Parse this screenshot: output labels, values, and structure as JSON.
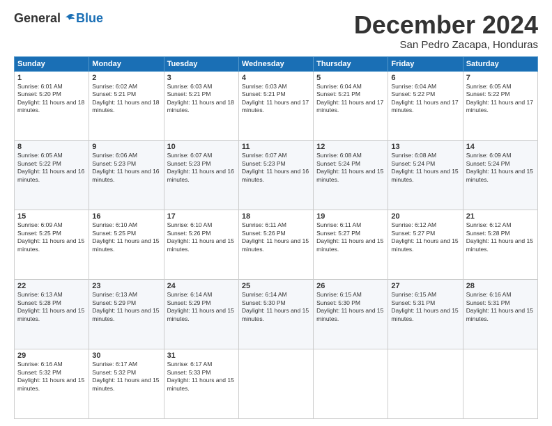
{
  "logo": {
    "general": "General",
    "blue": "Blue"
  },
  "title": "December 2024",
  "location": "San Pedro Zacapa, Honduras",
  "weekdays": [
    "Sunday",
    "Monday",
    "Tuesday",
    "Wednesday",
    "Thursday",
    "Friday",
    "Saturday"
  ],
  "weeks": [
    [
      {
        "day": "1",
        "sunrise": "6:01 AM",
        "sunset": "5:20 PM",
        "daylight": "11 hours and 18 minutes."
      },
      {
        "day": "2",
        "sunrise": "6:02 AM",
        "sunset": "5:21 PM",
        "daylight": "11 hours and 18 minutes."
      },
      {
        "day": "3",
        "sunrise": "6:03 AM",
        "sunset": "5:21 PM",
        "daylight": "11 hours and 18 minutes."
      },
      {
        "day": "4",
        "sunrise": "6:03 AM",
        "sunset": "5:21 PM",
        "daylight": "11 hours and 17 minutes."
      },
      {
        "day": "5",
        "sunrise": "6:04 AM",
        "sunset": "5:21 PM",
        "daylight": "11 hours and 17 minutes."
      },
      {
        "day": "6",
        "sunrise": "6:04 AM",
        "sunset": "5:22 PM",
        "daylight": "11 hours and 17 minutes."
      },
      {
        "day": "7",
        "sunrise": "6:05 AM",
        "sunset": "5:22 PM",
        "daylight": "11 hours and 17 minutes."
      }
    ],
    [
      {
        "day": "8",
        "sunrise": "6:05 AM",
        "sunset": "5:22 PM",
        "daylight": "11 hours and 16 minutes."
      },
      {
        "day": "9",
        "sunrise": "6:06 AM",
        "sunset": "5:23 PM",
        "daylight": "11 hours and 16 minutes."
      },
      {
        "day": "10",
        "sunrise": "6:07 AM",
        "sunset": "5:23 PM",
        "daylight": "11 hours and 16 minutes."
      },
      {
        "day": "11",
        "sunrise": "6:07 AM",
        "sunset": "5:23 PM",
        "daylight": "11 hours and 16 minutes."
      },
      {
        "day": "12",
        "sunrise": "6:08 AM",
        "sunset": "5:24 PM",
        "daylight": "11 hours and 15 minutes."
      },
      {
        "day": "13",
        "sunrise": "6:08 AM",
        "sunset": "5:24 PM",
        "daylight": "11 hours and 15 minutes."
      },
      {
        "day": "14",
        "sunrise": "6:09 AM",
        "sunset": "5:24 PM",
        "daylight": "11 hours and 15 minutes."
      }
    ],
    [
      {
        "day": "15",
        "sunrise": "6:09 AM",
        "sunset": "5:25 PM",
        "daylight": "11 hours and 15 minutes."
      },
      {
        "day": "16",
        "sunrise": "6:10 AM",
        "sunset": "5:25 PM",
        "daylight": "11 hours and 15 minutes."
      },
      {
        "day": "17",
        "sunrise": "6:10 AM",
        "sunset": "5:26 PM",
        "daylight": "11 hours and 15 minutes."
      },
      {
        "day": "18",
        "sunrise": "6:11 AM",
        "sunset": "5:26 PM",
        "daylight": "11 hours and 15 minutes."
      },
      {
        "day": "19",
        "sunrise": "6:11 AM",
        "sunset": "5:27 PM",
        "daylight": "11 hours and 15 minutes."
      },
      {
        "day": "20",
        "sunrise": "6:12 AM",
        "sunset": "5:27 PM",
        "daylight": "11 hours and 15 minutes."
      },
      {
        "day": "21",
        "sunrise": "6:12 AM",
        "sunset": "5:28 PM",
        "daylight": "11 hours and 15 minutes."
      }
    ],
    [
      {
        "day": "22",
        "sunrise": "6:13 AM",
        "sunset": "5:28 PM",
        "daylight": "11 hours and 15 minutes."
      },
      {
        "day": "23",
        "sunrise": "6:13 AM",
        "sunset": "5:29 PM",
        "daylight": "11 hours and 15 minutes."
      },
      {
        "day": "24",
        "sunrise": "6:14 AM",
        "sunset": "5:29 PM",
        "daylight": "11 hours and 15 minutes."
      },
      {
        "day": "25",
        "sunrise": "6:14 AM",
        "sunset": "5:30 PM",
        "daylight": "11 hours and 15 minutes."
      },
      {
        "day": "26",
        "sunrise": "6:15 AM",
        "sunset": "5:30 PM",
        "daylight": "11 hours and 15 minutes."
      },
      {
        "day": "27",
        "sunrise": "6:15 AM",
        "sunset": "5:31 PM",
        "daylight": "11 hours and 15 minutes."
      },
      {
        "day": "28",
        "sunrise": "6:16 AM",
        "sunset": "5:31 PM",
        "daylight": "11 hours and 15 minutes."
      }
    ],
    [
      {
        "day": "29",
        "sunrise": "6:16 AM",
        "sunset": "5:32 PM",
        "daylight": "11 hours and 15 minutes."
      },
      {
        "day": "30",
        "sunrise": "6:17 AM",
        "sunset": "5:32 PM",
        "daylight": "11 hours and 15 minutes."
      },
      {
        "day": "31",
        "sunrise": "6:17 AM",
        "sunset": "5:33 PM",
        "daylight": "11 hours and 15 minutes."
      },
      null,
      null,
      null,
      null
    ]
  ]
}
